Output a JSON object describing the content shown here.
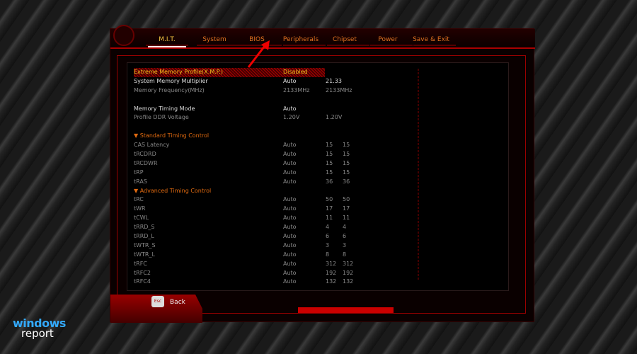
{
  "tabs": [
    {
      "label": "M.I.T."
    },
    {
      "label": "System"
    },
    {
      "label": "BIOS"
    },
    {
      "label": "Peripherals"
    },
    {
      "label": "Chipset"
    },
    {
      "label": "Power"
    },
    {
      "label": "Save & Exit"
    }
  ],
  "rows": [
    {
      "type": "sel",
      "label": "Extreme Memory Profile(X.M.P.)",
      "v1": "Disabled",
      "v2": "",
      "v3": ""
    },
    {
      "type": "w",
      "label": "System Memory Multiplier",
      "v1": "Auto",
      "v2": "21.33",
      "v3": ""
    },
    {
      "type": "g",
      "label": "Memory Frequency(MHz)",
      "v1": "2133MHz",
      "v2": "2133MHz",
      "v3": ""
    },
    {
      "type": "blank",
      "label": "",
      "v1": "",
      "v2": "",
      "v3": ""
    },
    {
      "type": "w",
      "label": "Memory Timing Mode",
      "v1": "Auto",
      "v2": "",
      "v3": ""
    },
    {
      "type": "g",
      "label": "Profile DDR Voltage",
      "v1": "1.20V",
      "v2": "1.20V",
      "v3": ""
    },
    {
      "type": "blank",
      "label": "",
      "v1": "",
      "v2": "",
      "v3": ""
    },
    {
      "type": "sec",
      "label": "▼ Standard Timing Control",
      "v1": "",
      "v2": "",
      "v3": ""
    },
    {
      "type": "g",
      "label": "CAS Latency",
      "v1": "Auto",
      "v2": "15",
      "v3": "15"
    },
    {
      "type": "g",
      "label": "tRCDRD",
      "v1": "Auto",
      "v2": "15",
      "v3": "15"
    },
    {
      "type": "g",
      "label": "tRCDWR",
      "v1": "Auto",
      "v2": "15",
      "v3": "15"
    },
    {
      "type": "g",
      "label": "tRP",
      "v1": "Auto",
      "v2": "15",
      "v3": "15"
    },
    {
      "type": "g",
      "label": "tRAS",
      "v1": "Auto",
      "v2": "36",
      "v3": "36"
    },
    {
      "type": "sec",
      "label": "▼ Advanced Timing Control",
      "v1": "",
      "v2": "",
      "v3": ""
    },
    {
      "type": "g",
      "label": "tRC",
      "v1": "Auto",
      "v2": "50",
      "v3": "50"
    },
    {
      "type": "g",
      "label": "tWR",
      "v1": "Auto",
      "v2": "17",
      "v3": "17"
    },
    {
      "type": "g",
      "label": "tCWL",
      "v1": "Auto",
      "v2": "11",
      "v3": "11"
    },
    {
      "type": "g",
      "label": "tRRD_S",
      "v1": "Auto",
      "v2": "4",
      "v3": "4"
    },
    {
      "type": "g",
      "label": "tRRD_L",
      "v1": "Auto",
      "v2": "6",
      "v3": "6"
    },
    {
      "type": "g",
      "label": "tWTR_S",
      "v1": "Auto",
      "v2": "3",
      "v3": "3"
    },
    {
      "type": "g",
      "label": "tWTR_L",
      "v1": "Auto",
      "v2": "8",
      "v3": "8"
    },
    {
      "type": "g",
      "label": "tRFC",
      "v1": "Auto",
      "v2": "312",
      "v3": "312"
    },
    {
      "type": "g",
      "label": "tRFC2",
      "v1": "Auto",
      "v2": "192",
      "v3": "192"
    },
    {
      "type": "g",
      "label": "tRFC4",
      "v1": "Auto",
      "v2": "132",
      "v3": "132"
    }
  ],
  "footer": {
    "esc_key": "Esc",
    "back_label": "Back"
  },
  "watermark": {
    "line1": "windows",
    "line2": "report"
  }
}
